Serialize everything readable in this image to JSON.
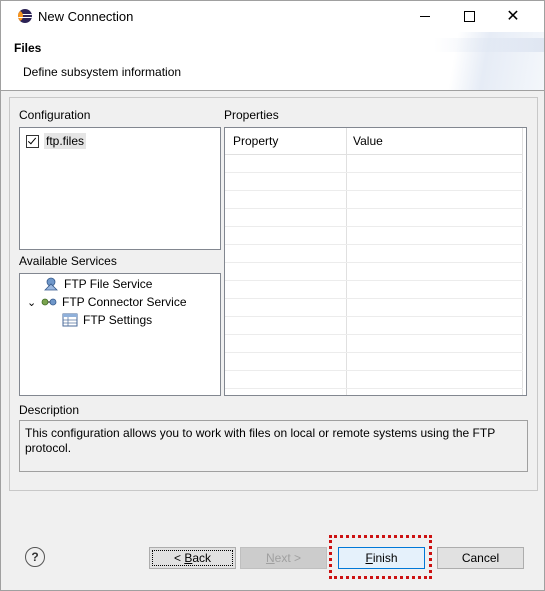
{
  "window": {
    "title": "New Connection"
  },
  "header": {
    "title": "Files",
    "description": "Define subsystem information"
  },
  "configuration": {
    "label": "Configuration",
    "items": [
      {
        "label": "ftp.files",
        "checked": true
      }
    ]
  },
  "services": {
    "label": "Available Services",
    "items": [
      {
        "label": "FTP File Service"
      },
      {
        "label": "FTP Connector Service"
      },
      {
        "label": "FTP Settings"
      }
    ]
  },
  "properties": {
    "label": "Properties",
    "columns": [
      "Property",
      "Value"
    ]
  },
  "description": {
    "label": "Description",
    "text": "This configuration allows you to work with files on local or remote systems using the FTP protocol."
  },
  "buttons": {
    "back": {
      "pre": "< ",
      "mnemonic": "B",
      "post": "ack"
    },
    "next": {
      "mnemonic": "N",
      "post": "ext >"
    },
    "finish": {
      "mnemonic": "F",
      "post": "inish"
    },
    "cancel": "Cancel",
    "help": "?"
  },
  "colors": {
    "highlight": "#cc1111",
    "default_button_border": "#0078d7"
  }
}
